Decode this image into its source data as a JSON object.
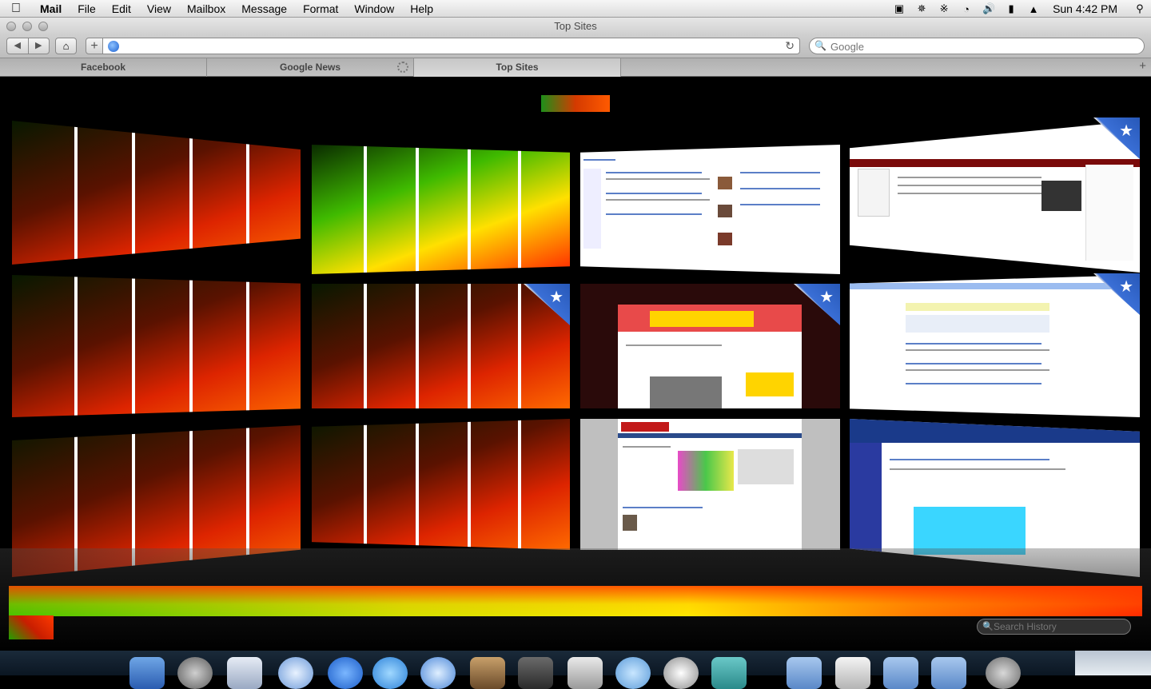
{
  "menubar": {
    "apple_icon": "apple-icon",
    "app_name": "Mail",
    "items": [
      "File",
      "Edit",
      "View",
      "Mailbox",
      "Message",
      "Format",
      "Window",
      "Help"
    ],
    "clock": "Sun 4:42 PM"
  },
  "window": {
    "title": "Top Sites"
  },
  "toolbar": {
    "back_label": "◀",
    "forward_label": "▶",
    "home_label": "⌂",
    "add_label": "+",
    "url_value": "",
    "reload_label": "↻",
    "search_placeholder": "Google"
  },
  "tabs": [
    {
      "label": "Facebook",
      "active": false
    },
    {
      "label": "Google News",
      "active": false,
      "loading": true
    },
    {
      "label": "Top Sites",
      "active": true
    }
  ],
  "tab_add_label": "+",
  "top_sites": {
    "search_history_placeholder": "Search History"
  },
  "colors": {
    "accent_green": "#49c400",
    "accent_red": "#ff2a00",
    "accent_orange": "#ff7a00",
    "star_blue": "#2758b8"
  }
}
